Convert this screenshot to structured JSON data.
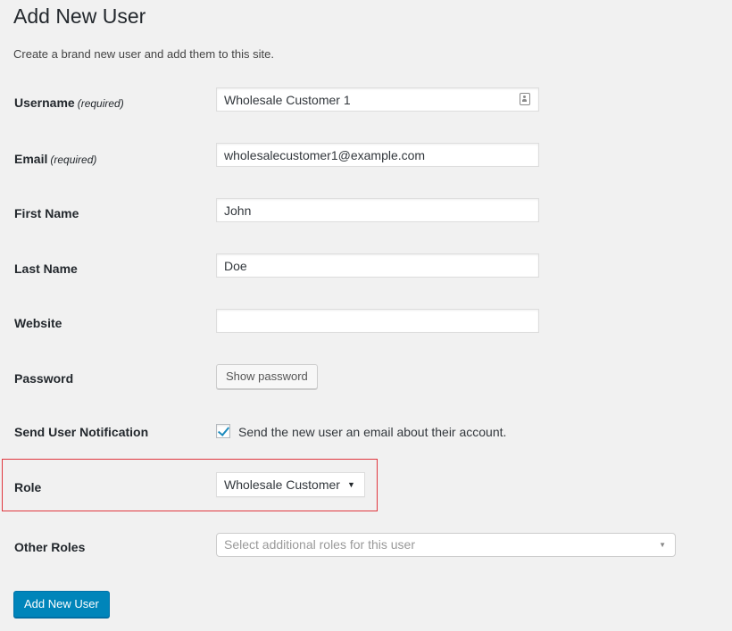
{
  "page": {
    "title": "Add New User",
    "description": "Create a brand new user and add them to this site."
  },
  "form": {
    "username": {
      "label": "Username",
      "required_tag": "(required)",
      "value": "Wholesale Customer 1",
      "icon": "contact-card-icon"
    },
    "email": {
      "label": "Email",
      "required_tag": "(required)",
      "value": "wholesalecustomer1@example.com"
    },
    "first_name": {
      "label": "First Name",
      "value": "John"
    },
    "last_name": {
      "label": "Last Name",
      "value": "Doe"
    },
    "website": {
      "label": "Website",
      "value": ""
    },
    "password": {
      "label": "Password",
      "button_label": "Show password"
    },
    "notification": {
      "label": "Send User Notification",
      "checked": true,
      "checkbox_label": "Send the new user an email about their account."
    },
    "role": {
      "label": "Role",
      "selected": "Wholesale Customer",
      "caret": "▼"
    },
    "other_roles": {
      "label": "Other Roles",
      "placeholder": "Select additional roles for this user",
      "caret": "▼"
    },
    "submit_label": "Add New User"
  },
  "colors": {
    "background": "#f1f1f1",
    "primary_button": "#0085ba",
    "highlight_border": "#e0373f",
    "checkmark": "#1e8cbe"
  }
}
